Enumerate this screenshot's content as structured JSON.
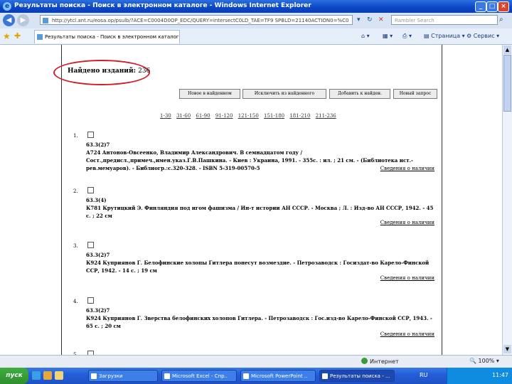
{
  "window": {
    "title": "Результаты поиска - Поиск в электронном каталоге - Windows Internet Explorer"
  },
  "addressbar": {
    "url": "http://ytcl.ant.ru/eosa.op/psulb/?ACE=C0004D0OP_EDC/QUERY=intersectC0LD_TAE=TF9 SPBLD=21140ACTION0=%C0",
    "search_placeholder": "Rambler Search"
  },
  "tab": {
    "label": "Результаты поиска - Поиск в электронном каталоге"
  },
  "commandbar": {
    "page_label": "Страница",
    "service_label": "Сервис"
  },
  "page": {
    "found_label": "Найдено изданий:",
    "found_count": "236",
    "buttons": [
      "Новое в найденном",
      "Исключить из найденного",
      "Добавить к найден.",
      "Новый запрос"
    ],
    "pager": [
      "1-30",
      "31-60",
      "61-90",
      "91-120",
      "121-150",
      "151-180",
      "181-210",
      "211-236"
    ],
    "availability_label": "Сведения о наличии",
    "records": [
      {
        "num": "1.",
        "code": "63.3(2)7",
        "body": "А724   Антонов-Овсеенко, Владимир Александрович. В семнадцатом году / Сост.,предисл.,примеч.,имен.указ.Г.В.Пашкина. - Киев : Украина, 1991. - 355с. : ил. ; 21 см. - (Библиотека ист.-рев.мемуаров). - Библиогр.:с.320-328. - ISBN 5-319-00570-5"
      },
      {
        "num": "2.",
        "code": "63.3(4)",
        "body": "К781   Крутицкий Э. Финляндия под игом фашизма / Ин-т истории АН СССР. - Москва ; Л. : Изд-во АН СССР, 1942. - 45 с. ; 22 см"
      },
      {
        "num": "3.",
        "code": "63.3(2)7",
        "body": "К924   Куприянов Г. Белофинские холопы Гитлера понесут возмездие. - Петрозаводск : Госиздат-во Карело-Финской ССР, 1942. - 14 с. ; 19 см"
      },
      {
        "num": "4.",
        "code": "63.3(2)7",
        "body": "К924   Куприянов Г. Зверства белофинских холопов Гитлера. - Петрозаводск : Гос.изд-во Карело-Финской ССР, 1943. - 65 с. ; 20 см"
      },
      {
        "num": "5.",
        "code": "",
        "body": ""
      }
    ]
  },
  "status": {
    "zone": "Интернет",
    "zoom": "100%"
  },
  "taskbar": {
    "start_label": "пуск",
    "tasks": [
      "Загрузки",
      "Microsoft Excel - Спр..",
      "Microsoft PowerPoint ..",
      "Результаты поиска - ..."
    ],
    "lang": "RU",
    "clock": "11:47"
  }
}
